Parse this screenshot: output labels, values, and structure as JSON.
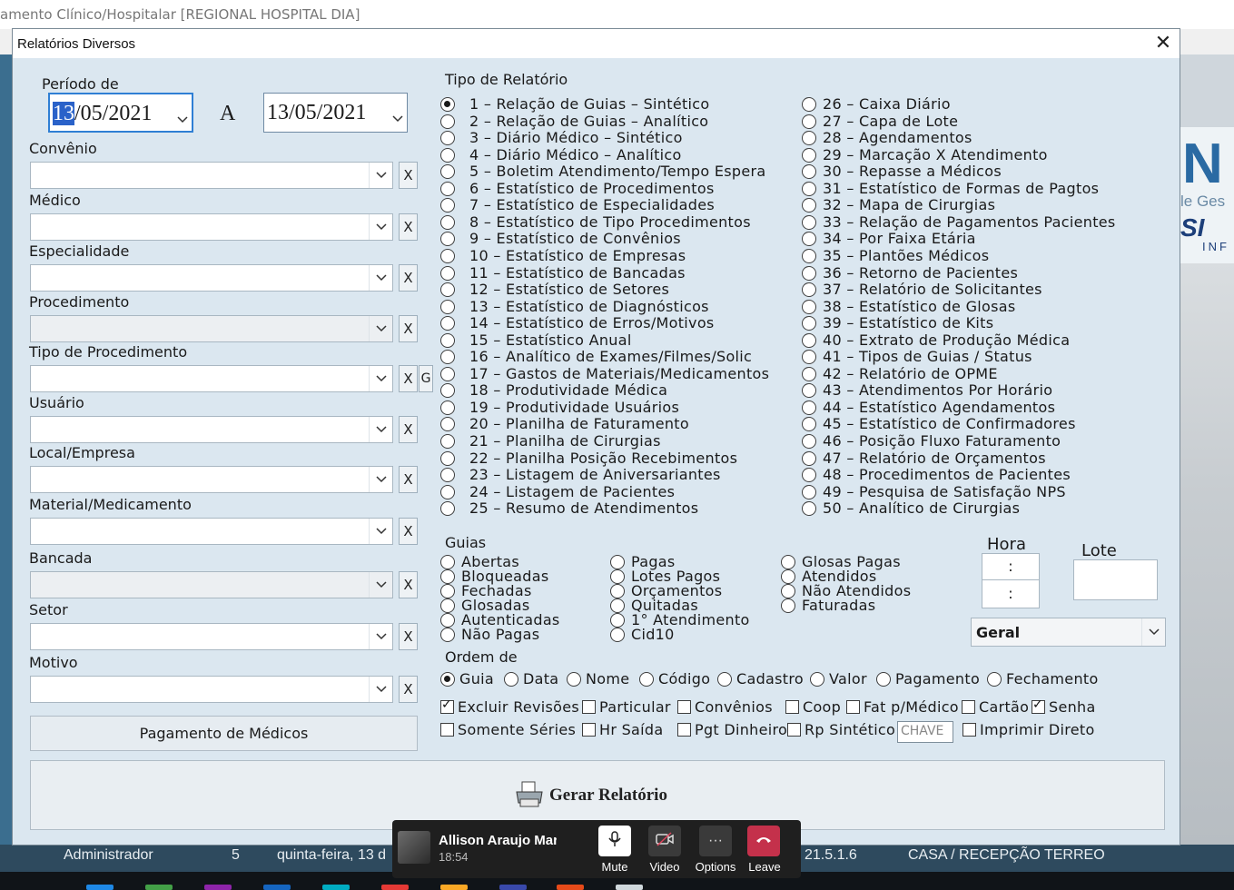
{
  "main_window": {
    "title": "amento Clínico/Hospitalar [REGIONAL HOSPITAL DIA]"
  },
  "dialog": {
    "title": "Relatórios Diversos",
    "periodo_label": "Período de",
    "date_from": "13/05/2021",
    "date_from_selected": "13",
    "date_from_rest": "/05/2021",
    "a_label": "A",
    "date_to": "13/05/2021",
    "filters": [
      {
        "label": "Convênio",
        "value": "",
        "has_g": false,
        "disabled": false
      },
      {
        "label": "Médico",
        "value": "",
        "has_g": false,
        "disabled": false
      },
      {
        "label": "Especialidade",
        "value": "",
        "has_g": false,
        "disabled": false
      },
      {
        "label": "Procedimento",
        "value": "",
        "has_g": false,
        "disabled": true
      },
      {
        "label": "Tipo de Procedimento",
        "value": "",
        "has_g": true,
        "disabled": false
      },
      {
        "label": "Usuário",
        "value": "",
        "has_g": false,
        "disabled": false
      },
      {
        "label": "Local/Empresa",
        "value": "",
        "has_g": false,
        "disabled": false
      },
      {
        "label": "Material/Medicamento",
        "value": "",
        "has_g": false,
        "disabled": false
      },
      {
        "label": "Bancada",
        "value": "",
        "has_g": false,
        "disabled": true
      },
      {
        "label": "Setor",
        "value": "",
        "has_g": false,
        "disabled": false
      },
      {
        "label": "Motivo",
        "value": "",
        "has_g": false,
        "disabled": false
      }
    ],
    "x_label": "X",
    "g_label": "G",
    "pagamento_button": "Pagamento de Médicos",
    "tipo_relatorio_label": "Tipo de Relatório",
    "reports_col1": [
      "1 – Relação de Guias – Sintético",
      "2 – Relação de Guias – Analítico",
      "3 – Diário Médico – Sintético",
      "4 – Diário Médico – Analítico",
      "5 – Boletim Atendimento/Tempo Espera",
      "6 – Estatístico de Procedimentos",
      "7 – Estatístico de Especialidades",
      "8 – Estatístico de Tipo Procedimentos",
      "9 – Estatístico de Convênios",
      "10 – Estatístico de Empresas",
      "11 – Estatístico de Bancadas",
      "12 – Estatístico de Setores",
      "13 – Estatístico de Diagnósticos",
      "14 – Estatístico de Erros/Motivos",
      "15 – Estatístico Anual",
      "16 – Analítico de Exames/Filmes/Solic",
      "17 – Gastos de Materiais/Medicamentos",
      "18 – Produtividade Médica",
      "19 – Produtividade Usuários",
      "20 – Planilha de Faturamento",
      "21 – Planilha de Cirurgias",
      "22 – Planilha Posição Recebimentos",
      "23 – Listagem de Aniversariantes",
      "24 – Listagem de Pacientes",
      "25 – Resumo de Atendimentos"
    ],
    "reports_col2": [
      "26 – Caixa Diário",
      "27 – Capa de Lote",
      "28 – Agendamentos",
      "29 – Marcação X Atendimento",
      "30 – Repasse a Médicos",
      "31 – Estatístico de Formas de Pagtos",
      "32 – Mapa de Cirurgias",
      "33 – Relação de Pagamentos Pacientes",
      "34 – Por Faixa Etária",
      "35 – Plantões Médicos",
      "36 – Retorno de Pacientes",
      "37 – Relatório de Solicitantes",
      "38 – Estatístico de Glosas",
      "39 – Estatístico de Kits",
      "40 – Extrato de Produção Médica",
      "41 – Tipos de Guias  /  Status",
      "42 – Relatório de OPME",
      "43 – Atendimentos Por Horário",
      "44 – Estatístico Agendamentos",
      "45 – Estatístico de Confirmadores",
      "46 – Posição Fluxo Faturamento",
      "47 – Relatório de Orçamentos",
      "48 – Procedimentos de Pacientes",
      "49 – Pesquisa de Satisfação NPS",
      "50 – Analítico de Cirurgias"
    ],
    "selected_report_index": 0,
    "guias_label": "Guias",
    "guias_col1": [
      "Abertas",
      "Bloqueadas",
      "Fechadas",
      "Glosadas",
      "Autenticadas",
      "Não Pagas"
    ],
    "guias_col2": [
      "Pagas",
      "Lotes Pagos",
      "Orçamentos",
      "Quitadas",
      "1° Atendimento",
      "Cid10"
    ],
    "guias_col3": [
      "Glosas Pagas",
      "Atendidos",
      "Não Atendidos",
      "Faturadas"
    ],
    "hora_label": "Hora",
    "hora1": ":",
    "hora2": ":",
    "lote_label": "Lote",
    "lote_value": "",
    "geral_select": "Geral",
    "ordem_label": "Ordem de",
    "ordem_options": [
      "Guia",
      "Data",
      "Nome",
      "Código",
      "Cadastro",
      "Valor",
      "Pagamento",
      "Fechamento"
    ],
    "ordem_selected": "Guia",
    "checks_row1": [
      {
        "label": "Excluir Revisões",
        "checked": true
      },
      {
        "label": "Particular",
        "checked": false
      },
      {
        "label": "Convênios",
        "checked": false
      },
      {
        "label": "Coop",
        "checked": false
      },
      {
        "label": "Fat p/Médico",
        "checked": false
      },
      {
        "label": "Cartão",
        "checked": false
      },
      {
        "label": "Senha",
        "checked": true
      }
    ],
    "checks_row2": [
      {
        "label": "Somente Séries",
        "checked": false
      },
      {
        "label": "Hr Saída",
        "checked": false
      },
      {
        "label": "Pgt Dinheiro",
        "checked": false
      },
      {
        "label": "Rp Sintético",
        "checked": false
      },
      {
        "label": "Imprimir Direto",
        "checked": false
      }
    ],
    "chave_placeholder": "CHAVE",
    "gerar_button": "Gerar Relatório"
  },
  "statusbar": {
    "user": "Administrador",
    "number": "5",
    "date": "quinta-feira, 13 d",
    "version": "21.5.1.6",
    "location": "CASA / RECEPÇÃO TERREO"
  },
  "teams_call": {
    "name": "Allison Araujo Marc",
    "time": "18:54",
    "mute_label": "Mute",
    "video_label": "Video",
    "options_label": "Options",
    "leave_label": "Leave"
  },
  "colors": {
    "dialog_bg": "#dbe7f0",
    "leave_red": "#c4314b",
    "accent_blue": "#2a62c9"
  }
}
